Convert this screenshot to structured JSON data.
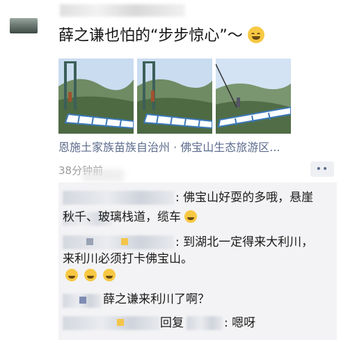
{
  "post": {
    "text": "薛之谦也怕的“步步惊心”～",
    "emoji_icon": "laughing-face-emoji",
    "location": "恩施土家族苗族自治州 · 佛宝山生态旅游区...",
    "time": "38分钟前",
    "more_label": "••"
  },
  "comments": [
    {
      "line1": ": 佛宝山好耍的多哦，悬崖",
      "line2": "秋千、玻璃栈道，缆车"
    },
    {
      "line1": ": 到湖北一定得来大利川，",
      "line2": "来利川必须打卡佛宝山。"
    },
    {
      "line1": "薛之谦来利川了啊？"
    },
    {
      "reply_word": "回复",
      "line1": ": 嗯呀"
    }
  ],
  "colors": {
    "link": "#5b6b8c",
    "time": "#9b9b9b",
    "comment_bg": "#f3f3f5",
    "emoji": "#f7c843"
  }
}
